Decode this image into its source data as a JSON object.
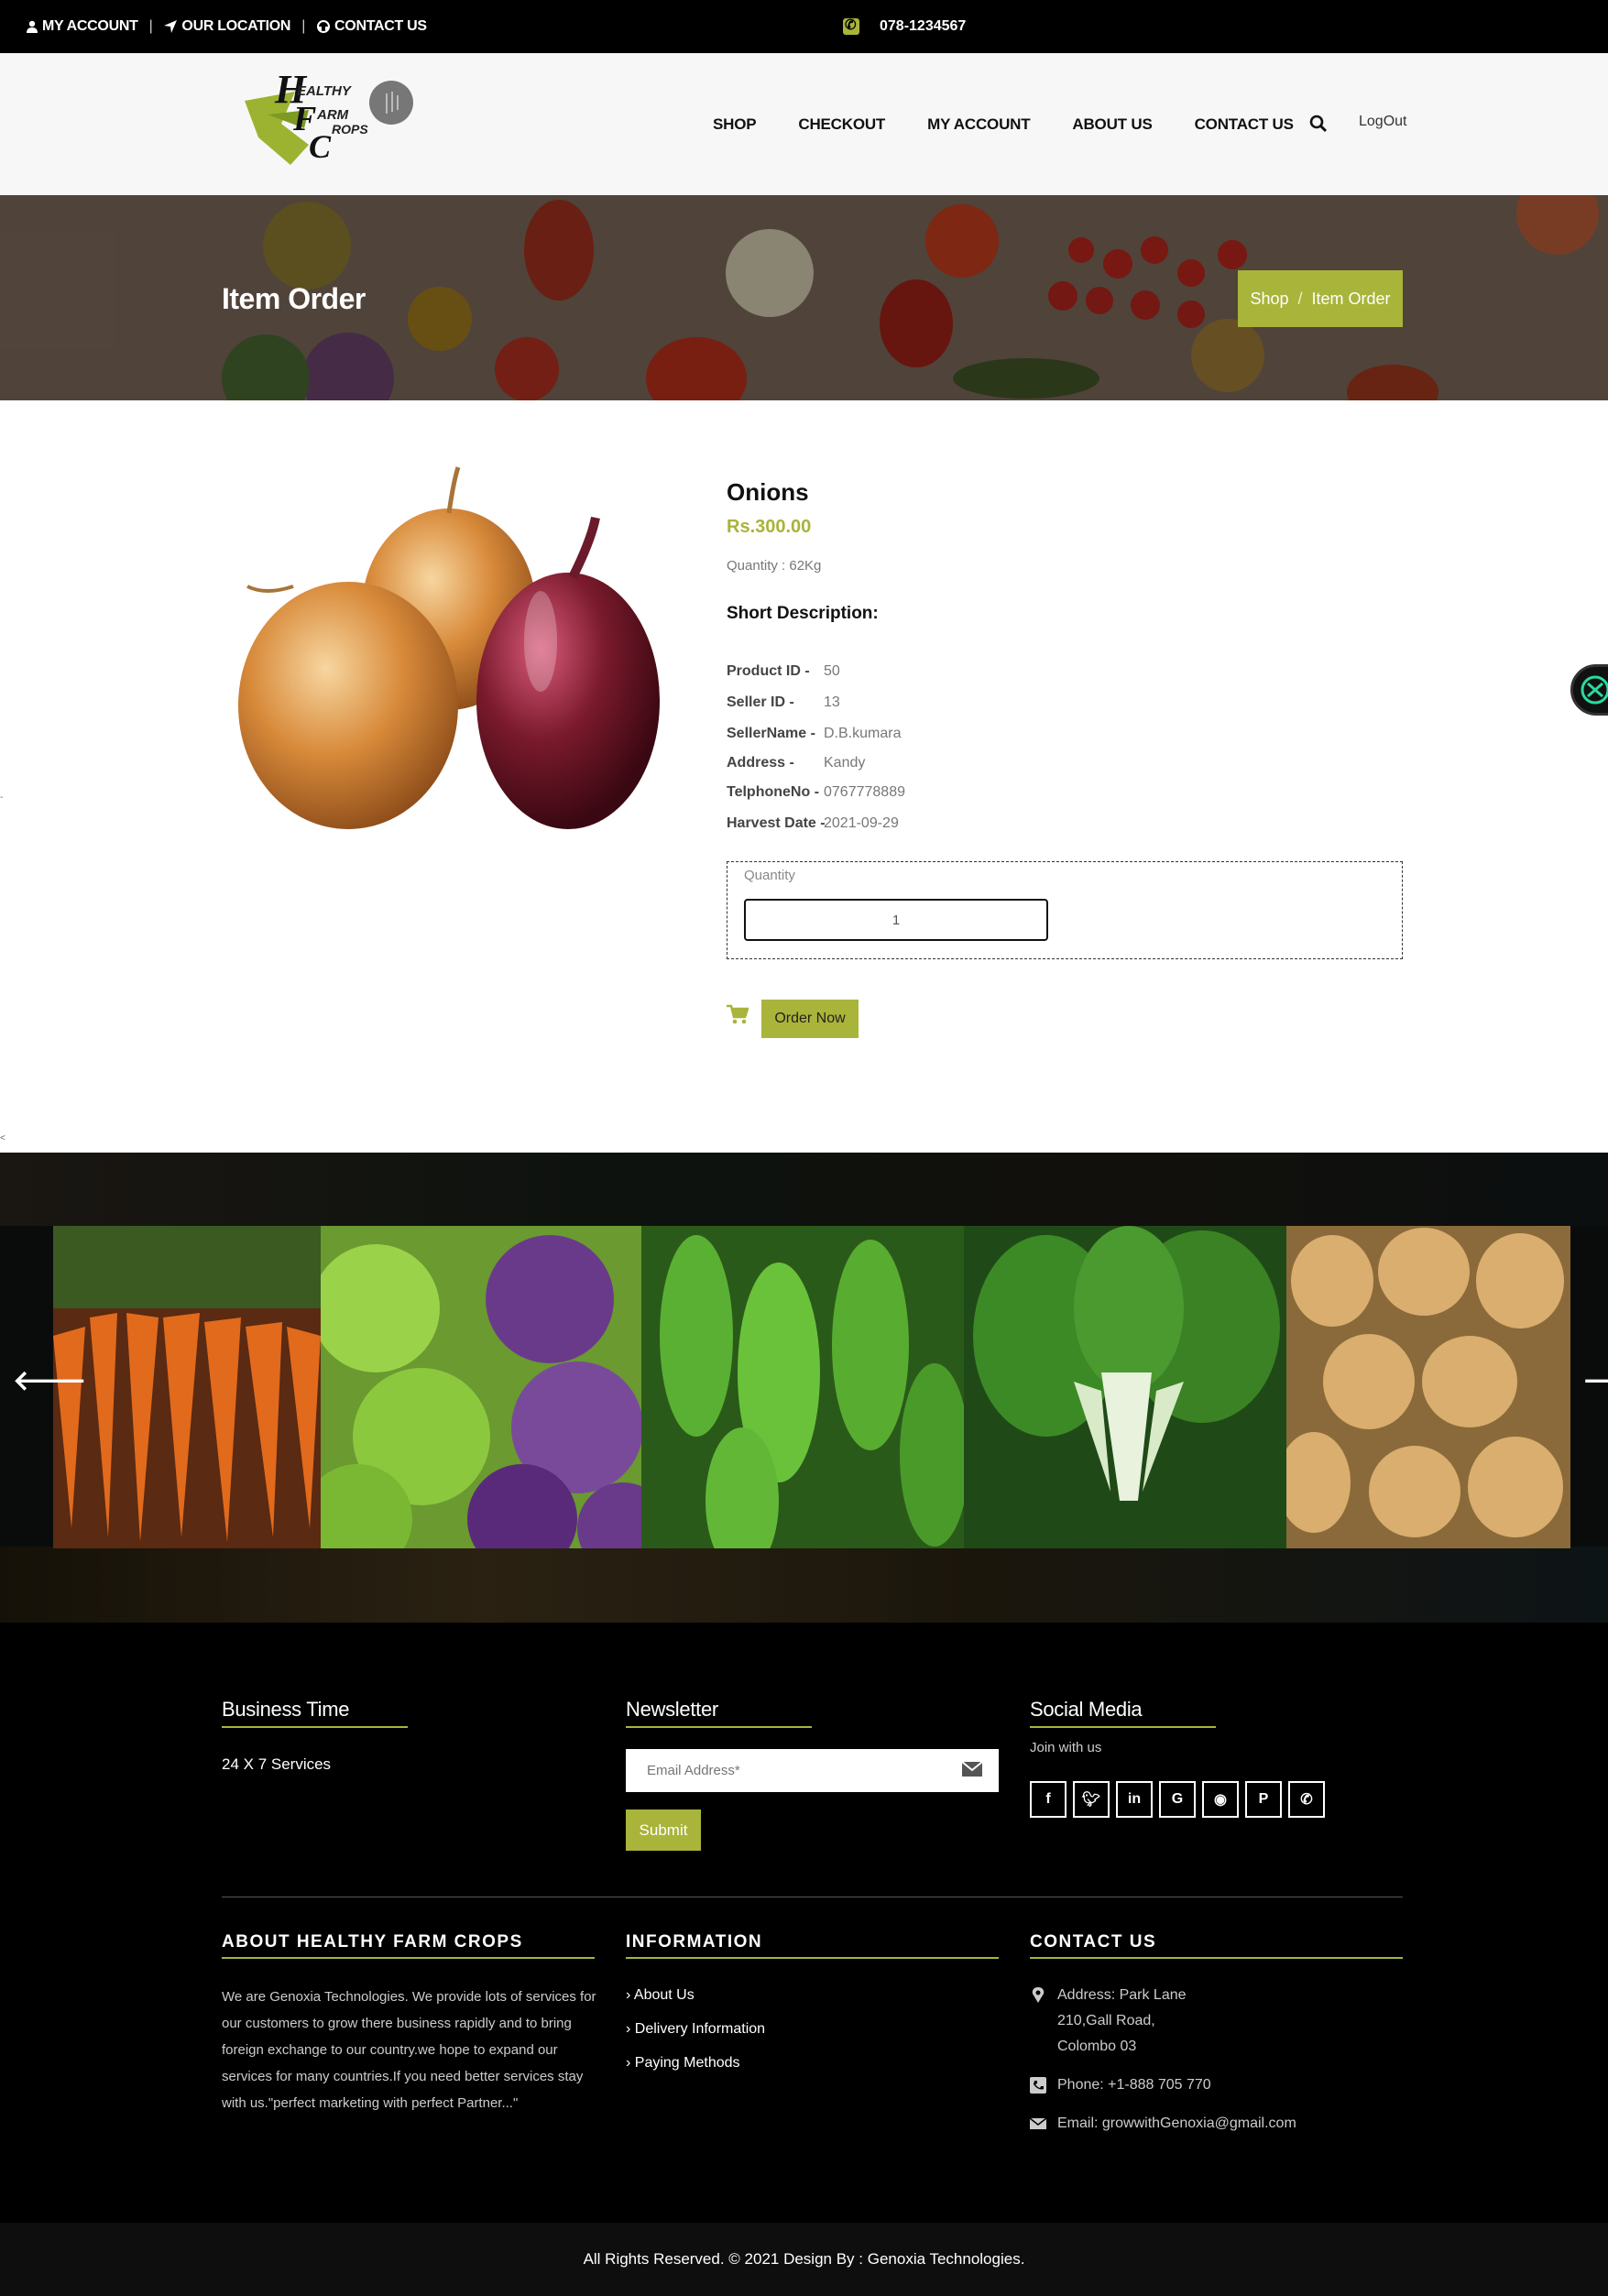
{
  "topbar": {
    "my_account": "MY ACCOUNT",
    "our_location": "OUR LOCATION",
    "contact_us": "CONTACT US",
    "phone": "078-1234567"
  },
  "nav": {
    "items": [
      "SHOP",
      "CHECKOUT",
      "MY ACCOUNT",
      "ABOUT US",
      "CONTACT US"
    ],
    "logout": "LogOut"
  },
  "banner": {
    "title": "Item Order",
    "crumb_shop": "Shop",
    "crumb_sep": "/",
    "crumb_current": "Item Order"
  },
  "product": {
    "name": "Onions",
    "price": "Rs.300.00",
    "quantity_line": "Quantity : 62Kg",
    "short_desc_heading": "Short Description:",
    "specs": [
      {
        "key": "Product ID  -",
        "value": "50"
      },
      {
        "key": "Seller ID     -",
        "value": "13"
      },
      {
        "key": "SellerName -",
        "value": "D.B.kumara"
      },
      {
        "key": "Address      -",
        "value": "Kandy"
      },
      {
        "key": "TelphoneNo -",
        "value": "0767778889"
      },
      {
        "key": "Harvest Date -",
        "value": "2021-09-29"
      }
    ],
    "quantity_label": "Quantity",
    "quantity_value": "1",
    "order_button": "Order Now"
  },
  "marks": {
    "left_dot": "-",
    "left_lt": "<"
  },
  "slider": {
    "slides": [
      "carrots",
      "cabbage",
      "bitter-gourd",
      "bok-choy",
      "potatoes"
    ]
  },
  "footer": {
    "business_time_heading": "Business Time",
    "business_time_text": "24 X 7 Services",
    "newsletter_heading": "Newsletter",
    "email_placeholder": "Email Address*",
    "submit": "Submit",
    "social_heading": "Social Media",
    "join": "Join with us",
    "social_icons": [
      "facebook-icon",
      "twitter-icon",
      "linkedin-icon",
      "google-plus-icon",
      "rss-icon",
      "pinterest-icon",
      "whatsapp-icon"
    ],
    "about_heading": "ABOUT HEALTHY FARM CROPS",
    "about_text": "We are Genoxia Technologies. We provide lots of services for our customers to grow there business rapidly and to bring foreign exchange to our country.we hope to expand our services for many countries.If you need better services stay with us.\"perfect marketing with perfect Partner...\"",
    "info_heading": "INFORMATION",
    "info_links": [
      "About Us",
      "Delivery Information",
      "Paying Methods"
    ],
    "contact_heading": "CONTACT US",
    "address_line1": "Address: Park Lane",
    "address_line2": "210,Gall Road,",
    "address_line3": "Colombo 03",
    "phone": "Phone: +1-888 705 770",
    "email": "Email: growwithGenoxia@gmail.com",
    "copyright": "All Rights Reserved. © 2021 Design By : Genoxia Technologies."
  },
  "colors": {
    "accent": "#a9b43a",
    "topbar": "#000000",
    "nav_bg": "#f7f7f7"
  }
}
